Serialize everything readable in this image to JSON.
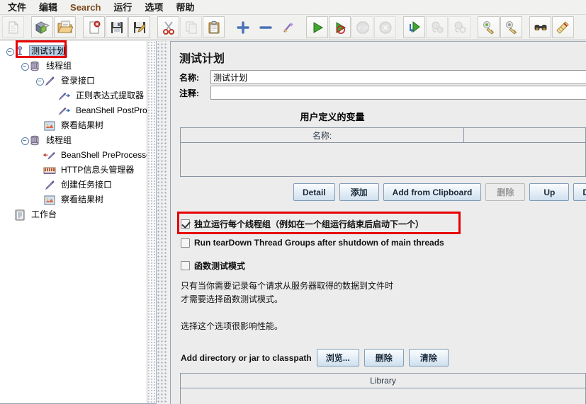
{
  "menu": {
    "items": [
      {
        "label": "文件",
        "name": "menu-file",
        "accent": false
      },
      {
        "label": "编辑",
        "name": "menu-edit",
        "accent": false
      },
      {
        "label": "Search",
        "name": "menu-search",
        "accent": true
      },
      {
        "label": "运行",
        "name": "menu-run",
        "accent": false
      },
      {
        "label": "选项",
        "name": "menu-options",
        "accent": false
      },
      {
        "label": "帮助",
        "name": "menu-help",
        "accent": false
      }
    ]
  },
  "toolbar": {
    "buttons": [
      {
        "icon": "new-icon",
        "disabled": true
      },
      {
        "icon": "templates-icon",
        "disabled": false
      },
      {
        "icon": "open-icon",
        "disabled": false
      },
      {
        "icon": "close-icon",
        "disabled": false
      },
      {
        "icon": "save-icon",
        "disabled": false
      },
      {
        "icon": "save-as-icon",
        "disabled": false
      },
      {
        "icon": "cut-icon",
        "disabled": false
      },
      {
        "icon": "copy-icon",
        "disabled": true
      },
      {
        "icon": "paste-icon",
        "disabled": false
      },
      {
        "icon": "expand-all-icon",
        "disabled": false
      },
      {
        "icon": "collapse-all-icon",
        "disabled": false
      },
      {
        "icon": "toggle-icon",
        "disabled": false
      },
      {
        "icon": "start-icon",
        "disabled": false
      },
      {
        "icon": "start-no-pauses-icon",
        "disabled": false
      },
      {
        "icon": "stop-icon",
        "disabled": true
      },
      {
        "icon": "shutdown-icon",
        "disabled": true
      },
      {
        "icon": "start-remote-all-icon",
        "disabled": false
      },
      {
        "icon": "stop-remote-all-icon",
        "disabled": true
      },
      {
        "icon": "shutdown-remote-all-icon",
        "disabled": true
      },
      {
        "icon": "clear-icon",
        "disabled": false
      },
      {
        "icon": "clear-all-icon",
        "disabled": false
      },
      {
        "icon": "search-icon",
        "disabled": false
      },
      {
        "icon": "reset-search-icon",
        "disabled": false
      }
    ]
  },
  "tree": {
    "nodes": [
      {
        "label": "测试计划",
        "icon": "test-plan-icon",
        "depth": 0,
        "selected": true,
        "expander": true
      },
      {
        "label": "线程组",
        "icon": "thread-group-icon",
        "depth": 1,
        "selected": false,
        "expander": true
      },
      {
        "label": "登录接口",
        "icon": "sampler-icon",
        "depth": 2,
        "selected": false,
        "expander": true
      },
      {
        "label": "正则表达式提取器",
        "icon": "post-processor-icon",
        "depth": 3,
        "selected": false,
        "expander": false
      },
      {
        "label": "BeanShell PostProcessor",
        "icon": "post-processor-icon",
        "depth": 3,
        "selected": false,
        "expander": false
      },
      {
        "label": "察看结果树",
        "icon": "listener-icon",
        "depth": 2,
        "selected": false,
        "expander": false
      },
      {
        "label": "线程组",
        "icon": "thread-group-icon",
        "depth": 1,
        "selected": false,
        "expander": true
      },
      {
        "label": "BeanShell PreProcessor",
        "icon": "pre-processor-icon",
        "depth": 2,
        "selected": false,
        "expander": false
      },
      {
        "label": "HTTP信息头管理器",
        "icon": "header-manager-icon",
        "depth": 2,
        "selected": false,
        "expander": false
      },
      {
        "label": "创建任务接口",
        "icon": "sampler-icon",
        "depth": 2,
        "selected": false,
        "expander": false
      },
      {
        "label": "察看结果树",
        "icon": "listener-icon",
        "depth": 2,
        "selected": false,
        "expander": false
      },
      {
        "label": "工作台",
        "icon": "workbench-icon",
        "depth": 0,
        "selected": false,
        "expander": false
      }
    ]
  },
  "panel": {
    "title": "测试计划",
    "name_label": "名称:",
    "name_value": "测试计划",
    "comment_label": "注释:",
    "comment_value": "",
    "udv": {
      "title": "用户定义的变量",
      "columns": [
        "名称:",
        ""
      ],
      "rows": [],
      "buttons": [
        {
          "label": "Detail",
          "name": "detail-button",
          "disabled": false
        },
        {
          "label": "添加",
          "name": "add-button",
          "disabled": false
        },
        {
          "label": "Add from Clipboard",
          "name": "add-from-clipboard-button",
          "disabled": false
        },
        {
          "label": "删除",
          "name": "delete-button",
          "disabled": true
        },
        {
          "label": "Up",
          "name": "up-button",
          "disabled": false
        },
        {
          "label": "Down",
          "name": "down-button",
          "disabled": false
        }
      ]
    },
    "checkboxes": [
      {
        "label": "独立运行每个线程组（例如在一个组运行结束后启动下一个）",
        "checked": true,
        "name": "serialize-thread-groups-checkbox",
        "highlighted": true
      },
      {
        "label": "Run tearDown Thread Groups after shutdown of main threads",
        "checked": false,
        "name": "run-teardown-checkbox",
        "highlighted": false
      },
      {
        "label": "函数测试模式",
        "checked": false,
        "name": "functional-test-mode-checkbox",
        "highlighted": false
      }
    ],
    "description_lines": [
      "只有当你需要记录每个请求从服务器取得的数据到文件时",
      "才需要选择函数测试模式。",
      "",
      "选择这个选项很影响性能。"
    ],
    "classpath": {
      "label": "Add directory or jar to classpath",
      "buttons": [
        {
          "label": "浏览...",
          "name": "browse-button"
        },
        {
          "label": "删除",
          "name": "classpath-delete-button"
        },
        {
          "label": "清除",
          "name": "classpath-clear-button"
        }
      ],
      "table_header": "Library",
      "rows": []
    }
  },
  "colors": {
    "accent_menu": "#7a4a1e",
    "selection": "#b8cfe5",
    "highlight_box": "#e60000",
    "panel_bg": "#ececec",
    "tree_bg": "#ffffff"
  }
}
